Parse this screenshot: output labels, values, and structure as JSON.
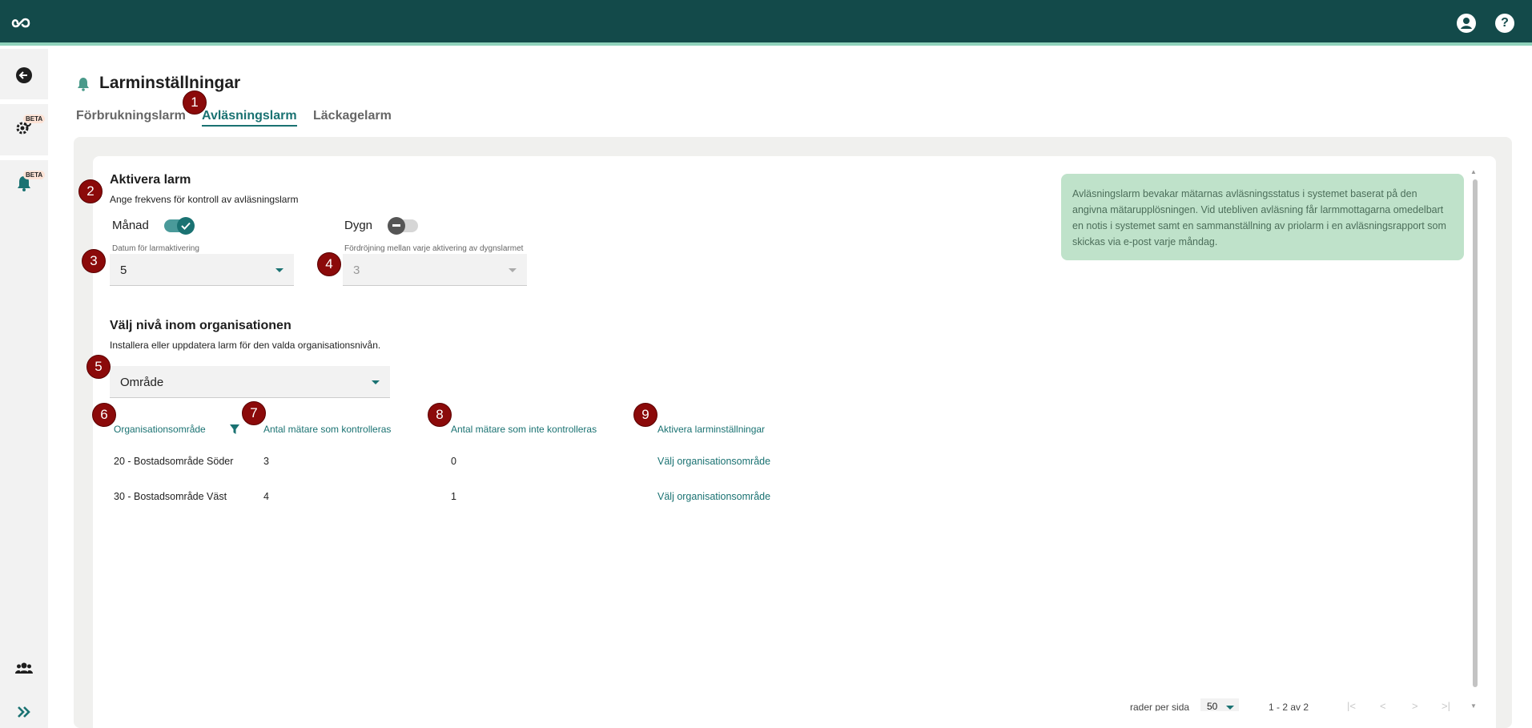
{
  "colors": {
    "topbar": "#134a4a",
    "accent": "#1a7272",
    "badge": "#8b0a0a",
    "info_bg": "#bfe2ca"
  },
  "header": {
    "logo_icon": "infinity-logo-icon",
    "user_icon": "account-circle-icon",
    "help_icon": "help-circle-icon"
  },
  "sidebar": {
    "back_icon": "arrow-left-circle-icon",
    "items": [
      {
        "icon": "gears-icon",
        "badge": "BETA"
      },
      {
        "icon": "bell-icon",
        "badge": "BETA"
      }
    ],
    "users_icon": "users-icon",
    "expand_icon": "double-chevron-right-icon"
  },
  "page": {
    "title": "Larminställningar",
    "tabs": [
      {
        "label": "Förbrukningslarm",
        "active": false
      },
      {
        "label": "Avläsningslarm",
        "active": true
      },
      {
        "label": "Läckagelarm",
        "active": false
      }
    ]
  },
  "badges": [
    "1",
    "2",
    "3",
    "4",
    "5",
    "6",
    "7",
    "8",
    "9"
  ],
  "activate": {
    "title": "Aktivera larm",
    "subtitle": "Ange frekvens för kontroll av avläsningslarm",
    "monthly_label": "Månad",
    "monthly_on": true,
    "daily_label": "Dygn",
    "daily_on": false,
    "date_label": "Datum för larmaktivering",
    "date_value": "5",
    "delay_label": "Fördröjning mellan varje aktivering av dygnslarmet",
    "delay_value": "3"
  },
  "info": {
    "text": "Avläsningslarm bevakar mätarnas avläsningsstatus i systemet baserat på den angivna mätarupplösningen. Vid utebliven avläsning får larmmottagarna omedelbart en notis i systemet samt en sammanställning av priolarm i en avläsningsrapport som skickas via e-post varje måndag."
  },
  "org": {
    "title": "Välj nivå inom organisationen",
    "subtitle": "Installera eller uppdatera larm för den valda organisationsnivån.",
    "level_value": "Område"
  },
  "table": {
    "headers": [
      "Organisationsområde",
      "Antal mätare som kontrolleras",
      "Antal mätare som inte kontrolleras",
      "Aktivera larminställningar"
    ],
    "filter_icon": "filter-icon",
    "rows": [
      {
        "area": "20 - Bostadsområde Söder",
        "checked": "3",
        "unchecked": "0",
        "action": "Välj organisationsområde"
      },
      {
        "area": "30 - Bostadsområde Väst",
        "checked": "4",
        "unchecked": "1",
        "action": "Välj organisationsområde"
      }
    ]
  },
  "pagination": {
    "rows_per_page_label": "rader per sida",
    "rows_per_page": "50",
    "range": "1 - 2 av 2"
  }
}
